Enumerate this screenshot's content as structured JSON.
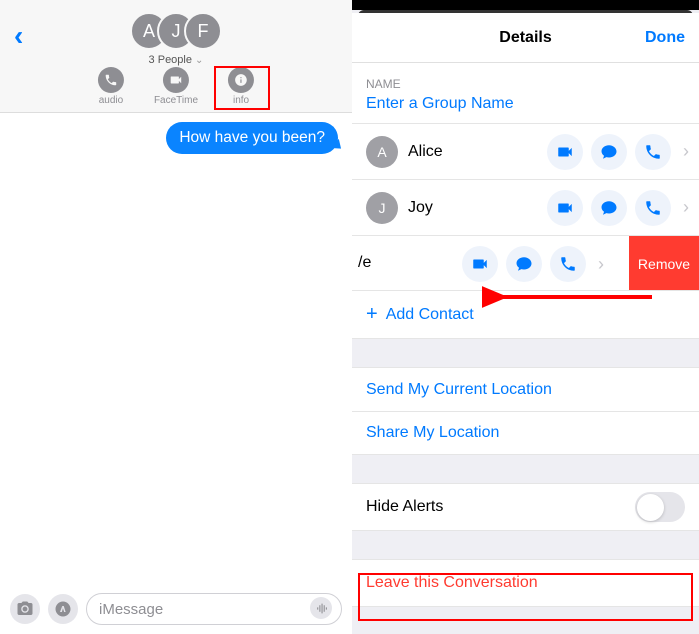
{
  "left": {
    "avatars": [
      "A",
      "J",
      "F"
    ],
    "people_count": "3 People",
    "actions": {
      "audio": "audio",
      "facetime": "FaceTime",
      "info": "info"
    },
    "message": "How have you been?",
    "input_placeholder": "iMessage"
  },
  "right": {
    "header_title": "Details",
    "done": "Done",
    "name_section_label": "NAME",
    "group_name_placeholder": "Enter a Group Name",
    "contacts": [
      {
        "initial": "A",
        "name": "Alice"
      },
      {
        "initial": "J",
        "name": "Joy"
      }
    ],
    "swiped_contact_fragment": "/e",
    "remove_label": "Remove",
    "add_contact": "Add Contact",
    "send_location": "Send My Current Location",
    "share_location": "Share My Location",
    "hide_alerts": "Hide Alerts",
    "leave": "Leave this Conversation"
  }
}
